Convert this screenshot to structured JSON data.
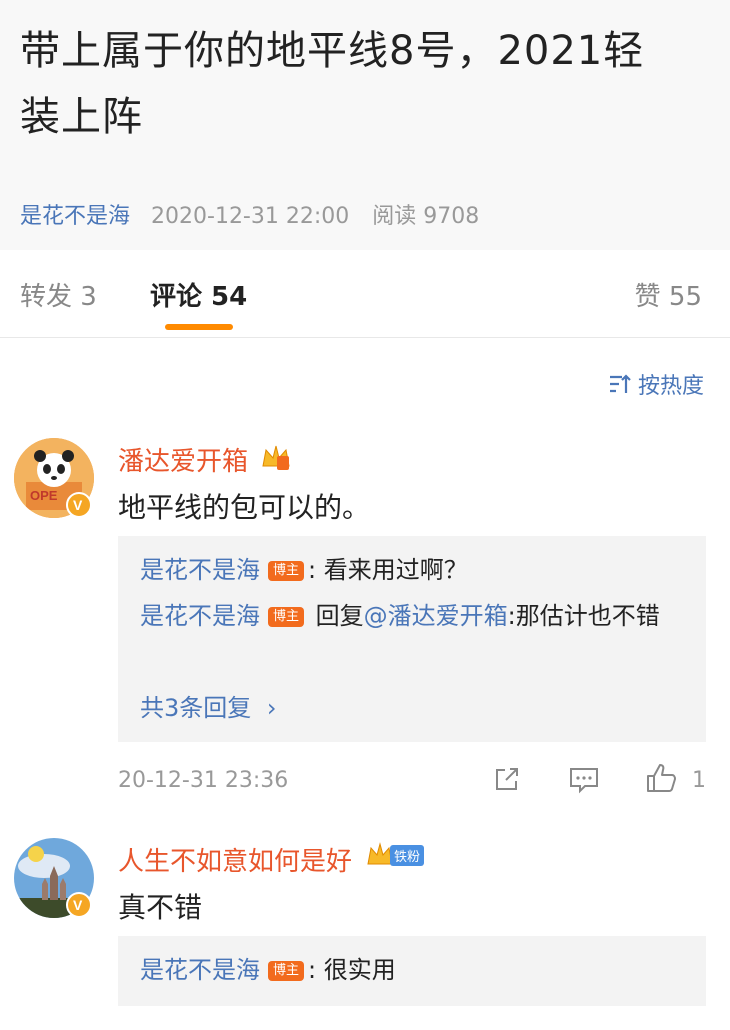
{
  "post": {
    "title": "带上属于你的地平线8号，2021轻装上阵",
    "author": "是花不是海",
    "date": "2020-12-31 22:00",
    "read_label": "阅读 9708"
  },
  "tabs": [
    {
      "label": "转发 3"
    },
    {
      "label": "评论 54"
    },
    {
      "label": "赞 55"
    }
  ],
  "sort_label": "按热度",
  "comments": [
    {
      "user": "潘达爱开箱",
      "text": "地平线的包可以的。",
      "replies": [
        {
          "name": "是花不是海",
          "tag": "博主",
          "text": ": 看来用过啊？"
        },
        {
          "name": "是花不是海",
          "tag": "博主",
          "prefix": " 回复",
          "mention": "@潘达爱开箱",
          "text": ":那估计也不错"
        }
      ],
      "more_replies": "共3条回复",
      "time": "20-12-31 23:36",
      "likes": "1"
    },
    {
      "user": "人生不如意如何是好",
      "fan_badge": "铁粉",
      "text": "真不错",
      "replies": [
        {
          "name": "是花不是海",
          "tag": "博主",
          "text": ": 很实用"
        }
      ]
    }
  ],
  "colors": {
    "accent": "#ff8a00",
    "link": "#4a76b8",
    "username": "#e8562c",
    "author_tag": "#f26b1d"
  }
}
